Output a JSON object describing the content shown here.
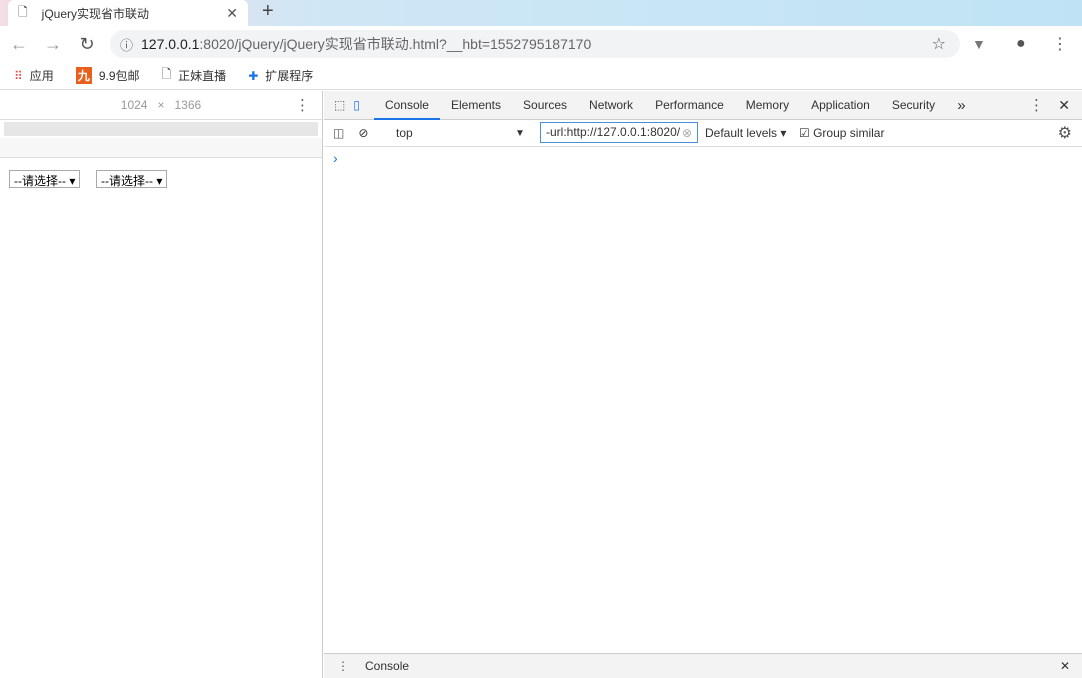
{
  "browser": {
    "tab_title": "jQuery实现省市联动",
    "url_host": "127.0.0.1",
    "url_rest": ":8020/jQuery/jQuery实现省市联动.html?__hbt=1552795187170",
    "bookmarks": [
      {
        "label": "应用"
      },
      {
        "label": "9.9包邮"
      },
      {
        "label": "正妹直播"
      },
      {
        "label": "扩展程序"
      }
    ]
  },
  "device": {
    "width": "1024",
    "x": "×",
    "height": "1366"
  },
  "page": {
    "select1": "--请选择--",
    "select2": "--请选择--"
  },
  "devtools": {
    "tabs": [
      "Console",
      "Elements",
      "Sources",
      "Network",
      "Performance",
      "Memory",
      "Application",
      "Security"
    ],
    "more": "»",
    "context": "top",
    "filter": "-url:http://127.0.0.1:8020/",
    "levels": "Default levels",
    "group_similar": "Group similar",
    "prompt": "›",
    "drawer_tab": "Console"
  },
  "colors": {
    "accent": "#1a73e8"
  }
}
